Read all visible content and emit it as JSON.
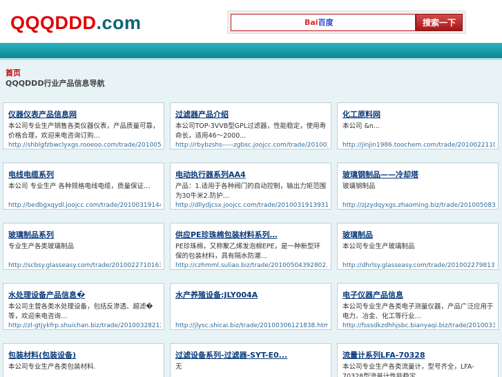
{
  "header": {
    "logo_left": "QQQDDD",
    "logo_right": ".com",
    "search_placeholder": "",
    "baidu_logo_a": "Bai",
    "baidu_logo_b": "百度",
    "search_button": "搜索一下"
  },
  "breadcrumb": {
    "home": "首页",
    "sub": "QQQDDD行业产品信息导航"
  },
  "cards": [
    {
      "title": "仪器仪表产品信息网",
      "desc": "本公司专业生产销售各类仪器仪表，产品质量可靠，价格合理，欢迎来电咨询订购…",
      "url": "http://shblgfzbwclyxgs.rooeoo.com/trade/20100513"
    },
    {
      "title": "过滤器产品介绍",
      "desc": " 本公司TOP-3VVB型GPL过滤器，性能稳定，使用寿命长，适用46～2000...",
      "url": "http://rbybzshs-----zgbsc.joojcc.com/trade/20100318"
    },
    {
      "title": "化工原料网",
      "desc": "本公司       &n...",
      "url": "http://jinjin1986.toochem.com/trade/20100221106"
    },
    {
      "title": "电线电缆系列",
      "desc": "本公司 专业生产     各种规格电线电缆，质量保证…",
      "url": "http://bedbgxqydl.joojcc.com/trade/201003191441"
    },
    {
      "title": "电动执行器系列AA4",
      "desc": "产品：1.适用于各种阀门的自动控制，输出力矩范围为30牛米2.防护...",
      "url": "http://dllydjcsx.joojcc.com/trade/20100319139316"
    },
    {
      "title": "玻璃钢制品——冷却塔",
      "desc": "玻璃钢制品",
      "url": "http://zjzydqyxgs.zhaoming.biz/trade/20100508391"
    },
    {
      "title": "玻璃制品系列",
      "desc": "专业生产各类玻璃制品",
      "url": "http://scbsy.glasseasy.com/trade/20100227101633"
    },
    {
      "title": "供应PE珍珠棉包装材料系列…",
      "desc": "PE珍珠棉，又称聚乙烯发泡棉EPE，是一种新型环保的包装材料，具有隔水防潮…",
      "url": "http://czhmml.suliao.biz/trade/20100504392802.html"
    },
    {
      "title": "玻璃制品",
      "desc": "本公司专业生产玻璃制品",
      "url": "http://dhrlsy.glasseasy.com/trade/20100227981376"
    },
    {
      "title": "水处理设备产品信息�",
      "desc": "本公司主营各类水处理设备，包括反渗透、超滤�等，欢迎来电咨询…",
      "url": "http://zl-gtjykfrp.shuichan.biz/trade/201003282123"
    },
    {
      "title": "水产养殖设备:JLY004A",
      "desc": "",
      "url": "http://jlysc.shicai.biz/trade/20100306121838.html"
    },
    {
      "title": "电子仪器产品信息",
      "desc": "本公司专业生产各类电子测量仪器，产品广泛应用于电力、冶金、化工等行业…",
      "url": "http://fsssdkzdhhjsbc.bianyaqi.biz/trade/20100330"
    },
    {
      "title": "包装材料(包装设备)",
      "desc": "本公司专业生产各类包装材料.",
      "url": ""
    },
    {
      "title": "过滤设备系列-过滤器-SYT-E0...",
      "desc": "无",
      "url": ""
    },
    {
      "title": "流量计系列LFA-70328",
      "desc": "本公司专业生产各类流量计，型号齐全，LFA-70328型流量计性能稳定",
      "url": ""
    }
  ]
}
